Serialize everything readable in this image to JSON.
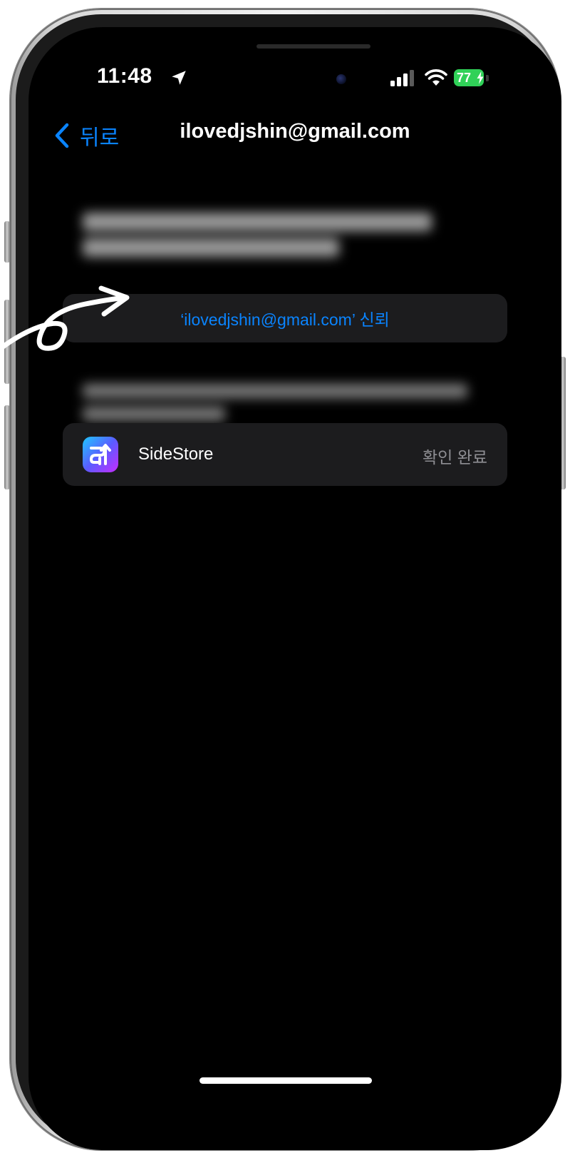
{
  "status_bar": {
    "time": "11:48",
    "battery_level": "77",
    "icons": [
      "location-arrow-icon",
      "signal-icon",
      "wifi-icon",
      "battery-charging-icon"
    ]
  },
  "nav": {
    "back_label": "뒤로",
    "title": "ilovedjshin@gmail.com"
  },
  "trust": {
    "label": "‘ilovedjshin@gmail.com’ 신뢰"
  },
  "app": {
    "name": "SideStore",
    "status": "확인 완료",
    "icon": "sidestore-app-icon"
  },
  "colors": {
    "accent": "#0a84ff",
    "background": "#000000",
    "cell": "#1c1c1e",
    "secondary_text": "#8e8e93",
    "battery": "#30d158"
  }
}
